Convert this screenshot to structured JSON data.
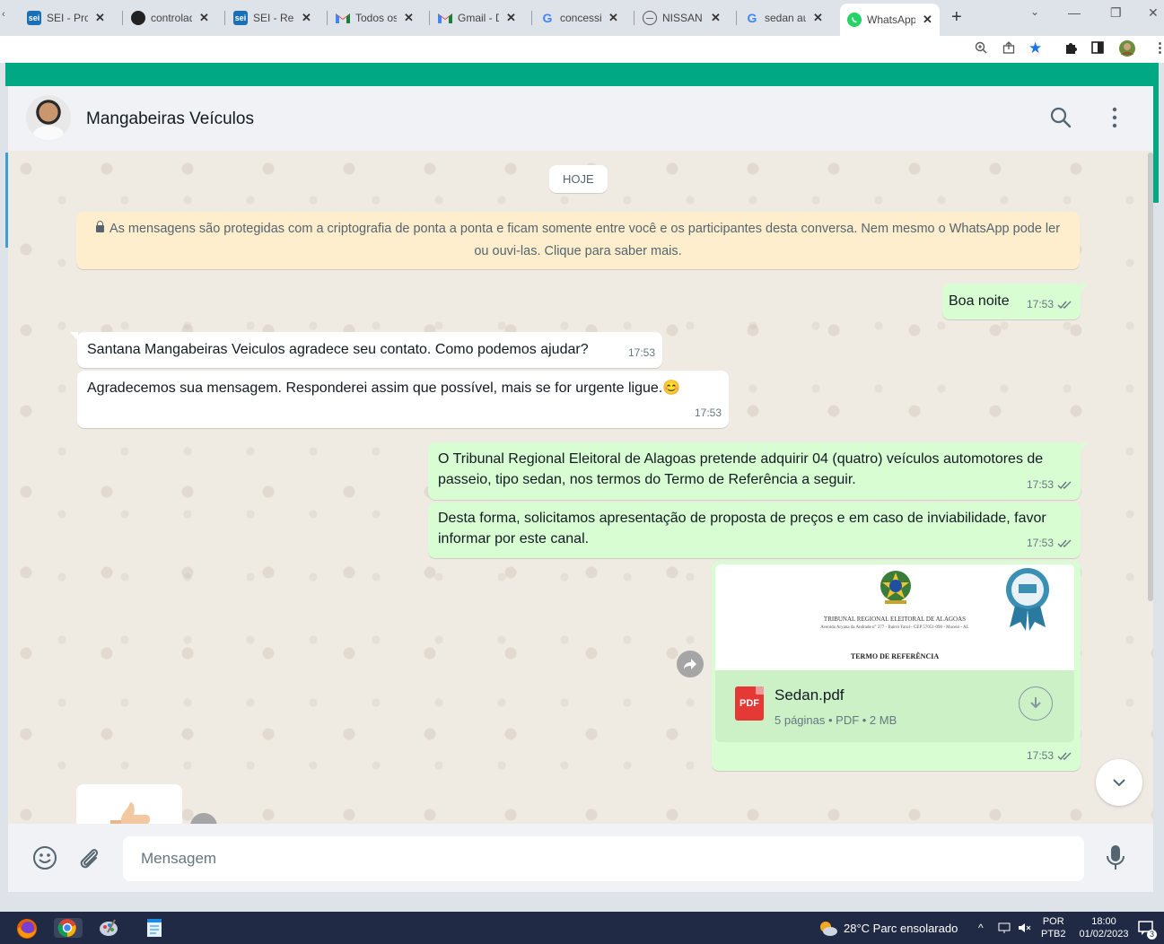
{
  "browser": {
    "tabs": [
      {
        "label": "SEI - Proc",
        "icon": "sei-favicon"
      },
      {
        "label": "controlad",
        "icon": "globe-favicon"
      },
      {
        "label": "SEI - Resu",
        "icon": "sei-favicon"
      },
      {
        "label": "Todos os",
        "icon": "gmail-favicon"
      },
      {
        "label": "Gmail - D",
        "icon": "gmail-favicon"
      },
      {
        "label": "concessio",
        "icon": "google-favicon"
      },
      {
        "label": "NISSAN V",
        "icon": "nissan-favicon"
      },
      {
        "label": "sedan aut",
        "icon": "google-favicon"
      },
      {
        "label": "WhatsApp",
        "icon": "whatsapp-favicon",
        "active": true
      }
    ],
    "sei_badge": "sei",
    "new_tab": "+",
    "pdf_badge_text": "PDF"
  },
  "header": {
    "contact_name": "Mangabeiras Veículos"
  },
  "chat": {
    "date_chip": "HOJE",
    "encryption_notice": "As mensagens são protegidas com a criptografia de ponta a ponta e ficam somente entre você e os participantes desta conversa. Nem mesmo o WhatsApp pode ler ou ouvi-las. Clique para saber mais.",
    "messages": [
      {
        "direction": "out",
        "text": "Boa noite",
        "time": "17:53"
      },
      {
        "direction": "in",
        "text": "Santana Mangabeiras Veiculos agradece seu contato. Como podemos ajudar?",
        "time": "17:53"
      },
      {
        "direction": "in",
        "text": "Agradecemos sua mensagem. Responderei assim que possível, mais se for urgente ligue.😊",
        "time": "17:53"
      },
      {
        "direction": "out",
        "text": "O Tribunal Regional Eleitoral de Alagoas pretende adquirir 04 (quatro) veículos automotores de passeio, tipo sedan, nos termos do Termo de Referência a seguir.",
        "time": "17:53"
      },
      {
        "direction": "out",
        "text": "Desta forma, solicitamos apresentação de proposta de preços e em caso de inviabilidade, favor informar por este canal.",
        "time": "17:53"
      }
    ],
    "document": {
      "preview_org": "TRIBUNAL REGIONAL ELEITORAL DE ALAGOAS",
      "preview_address": "Avenida Aryana da Andrade n° 377 - Bairro Farol - CEP 57051-090 - Maceió - AL",
      "preview_title": "TERMO DE REFERÊNCIA",
      "file_name": "Sedan.pdf",
      "file_info": "5 páginas • PDF • 2 MB",
      "time": "17:53"
    }
  },
  "composer": {
    "placeholder": "Mensagem"
  },
  "taskbar": {
    "weather": "28°C  Parc ensolarado",
    "lang_top": "POR",
    "lang_bottom": "PTB2",
    "time": "18:00",
    "date": "01/02/2023",
    "notifications": "3"
  },
  "colors": {
    "wa_green": "#00a884",
    "outgoing_bubble": "#d9fdd3",
    "incoming_bubble": "#ffffff",
    "tick_blue_grey": "#667781"
  }
}
